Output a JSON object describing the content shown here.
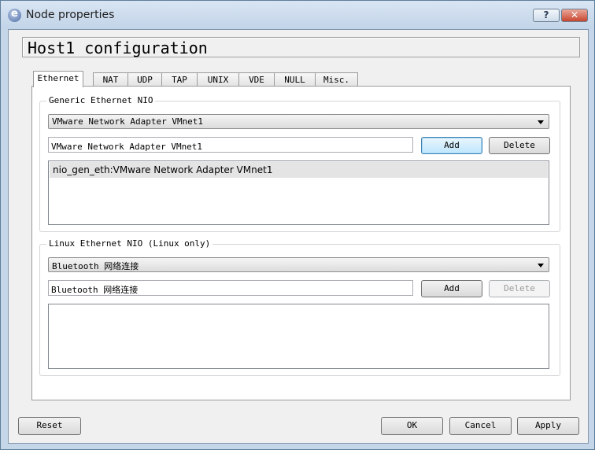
{
  "window": {
    "title": "Node properties",
    "help_label": "?",
    "close_label": "✕"
  },
  "header": {
    "title": "Host1 configuration"
  },
  "tabs": [
    {
      "label": "Ethernet"
    },
    {
      "label": "NAT"
    },
    {
      "label": "UDP"
    },
    {
      "label": "TAP"
    },
    {
      "label": "UNIX"
    },
    {
      "label": "VDE"
    },
    {
      "label": "NULL"
    },
    {
      "label": "Misc."
    }
  ],
  "active_tab": "Ethernet",
  "generic_nio": {
    "title": "Generic Ethernet NIO",
    "selected_adapter": "VMware Network Adapter VMnet1",
    "input_value": "VMware Network Adapter VMnet1",
    "add_label": "Add",
    "delete_label": "Delete",
    "items": [
      "nio_gen_eth:VMware Network Adapter VMnet1"
    ]
  },
  "linux_nio": {
    "title": "Linux Ethernet NIO (Linux only)",
    "selected_adapter": "Bluetooth 网络连接",
    "input_value": "Bluetooth 网络连接",
    "add_label": "Add",
    "delete_label": "Delete",
    "delete_enabled": false,
    "items": []
  },
  "footer": {
    "reset_label": "Reset",
    "ok_label": "OK",
    "cancel_label": "Cancel",
    "apply_label": "Apply"
  },
  "icons": {
    "app": "app-icon",
    "dropdown": "dropdown-arrow-icon"
  },
  "colors": {
    "title_bar": "#c5d6e9",
    "close_button": "#c9462f",
    "focus_button": "#bee6fd",
    "selected_row": "#e4e4e4"
  }
}
